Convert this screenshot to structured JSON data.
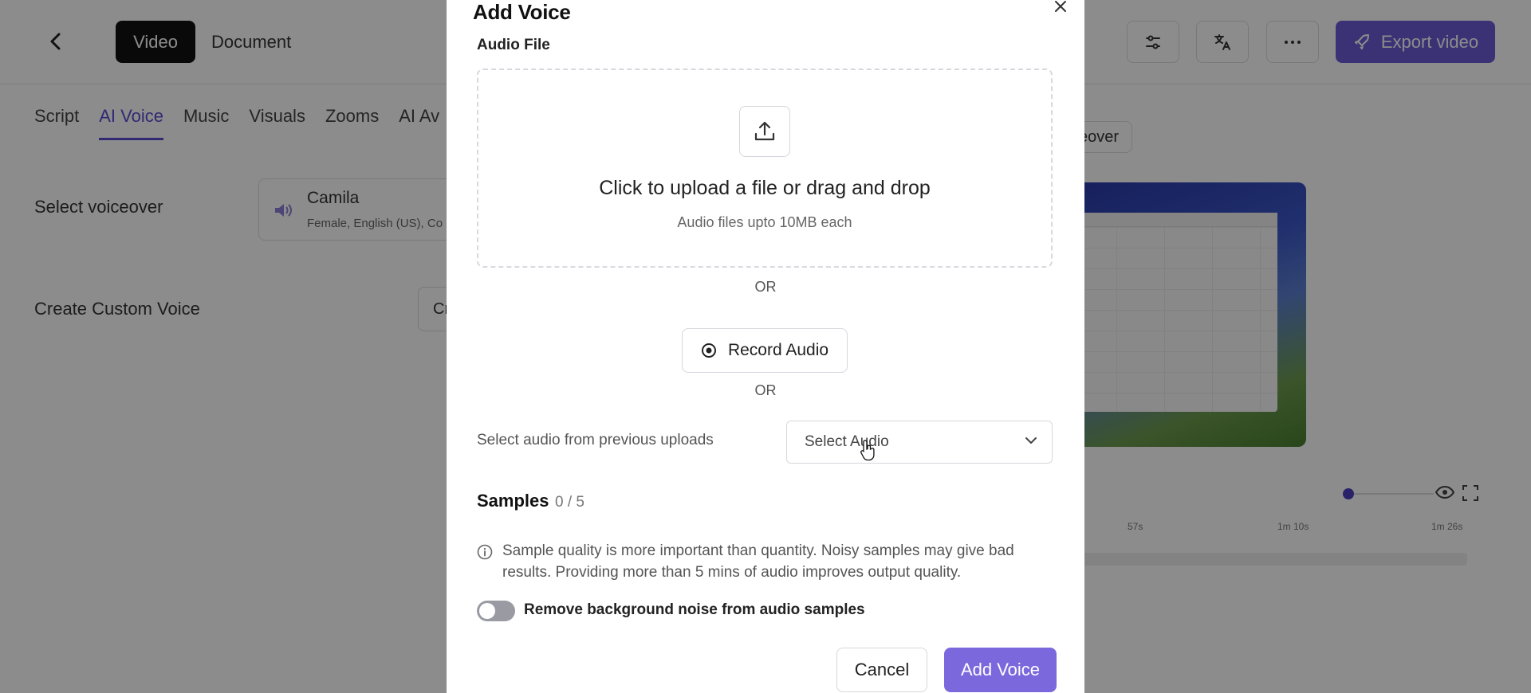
{
  "app": {
    "segments": {
      "video": "Video",
      "document": "Document"
    },
    "export_label": "Export video",
    "tabs": [
      "Script",
      "AI Voice",
      "Music",
      "Visuals",
      "Zooms",
      "AI Av"
    ],
    "active_tab": "AI Voice",
    "select_voiceover_label": "Select voiceover",
    "voice": {
      "name": "Camila",
      "meta": "Female, English (US), Co"
    },
    "create_custom_voice_label": "Create Custom Voice",
    "custom_button_partial": "Cr",
    "voiceover_chip_partial": "eover",
    "timeline_ticks": [
      "57s",
      "1m 10s",
      "1m 26s"
    ],
    "colors": {
      "accent": "#6b5bd6",
      "active_tab": "#5a4bd1"
    }
  },
  "modal": {
    "title": "Add Voice",
    "audio_file_label": "Audio File",
    "upload_text": "Click to upload a file or drag and drop",
    "upload_subtext": "Audio files upto 10MB each",
    "or_1": "OR",
    "record_label": "Record Audio",
    "or_2": "OR",
    "previous_uploads_label": "Select audio from previous uploads",
    "select_audio_placeholder": "Select Audio",
    "samples_label": "Samples",
    "samples_count": "0 / 5",
    "info_text": "Sample quality is more important than quantity. Noisy samples may give bad results. Providing more than 5 mins of audio improves output quality.",
    "toggle_label": "Remove background noise from audio samples",
    "toggle_on": false,
    "cancel_label": "Cancel",
    "add_voice_label": "Add Voice",
    "colors": {
      "primary_button": "#7b68dd"
    }
  }
}
